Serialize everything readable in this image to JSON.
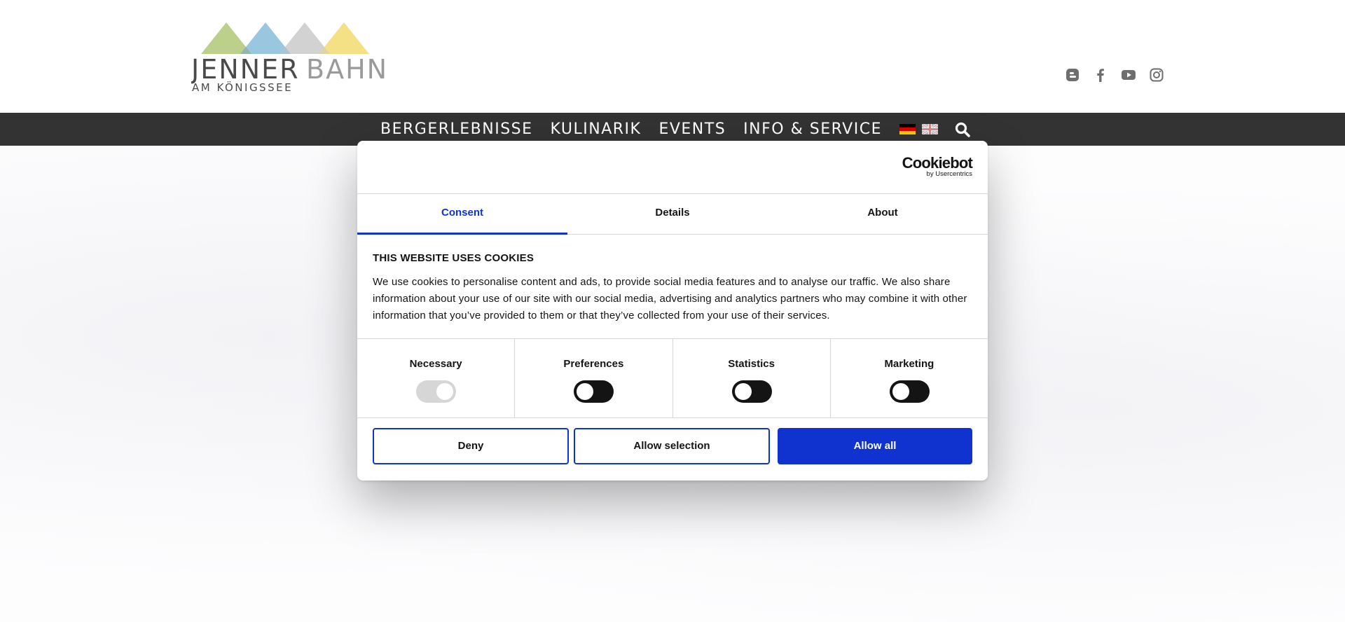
{
  "header": {
    "logo": {
      "brand_part1": "JENNER",
      "brand_part2": "BAHN",
      "tagline": "AM KÖNIGSSEE"
    },
    "social_icons": [
      "blogger-icon",
      "facebook-icon",
      "youtube-icon",
      "instagram-icon"
    ]
  },
  "nav": {
    "items": [
      {
        "label": "BERGERLEBNISSE"
      },
      {
        "label": "KULINARIK"
      },
      {
        "label": "EVENTS"
      },
      {
        "label": "INFO & SERVICE"
      }
    ],
    "flags": [
      "german-flag-icon",
      "uk-flag-icon"
    ],
    "search_icon": "search-icon"
  },
  "cookie_dialog": {
    "brand": "Cookiebot",
    "brand_sub": "by Usercentrics",
    "tabs": [
      {
        "label": "Consent",
        "active": true
      },
      {
        "label": "Details",
        "active": false
      },
      {
        "label": "About",
        "active": false
      }
    ],
    "title": "THIS WEBSITE USES COOKIES",
    "text": "We use cookies to personalise content and ads, to provide social media features and to analyse our traffic. We also share information about your use of our site with our social media, advertising and analytics partners who may combine it with other information that you’ve provided to them or that they’ve collected from your use of their services.",
    "categories": [
      {
        "label": "Necessary",
        "enabled": true,
        "locked": true
      },
      {
        "label": "Preferences",
        "enabled": false,
        "locked": false
      },
      {
        "label": "Statistics",
        "enabled": false,
        "locked": false
      },
      {
        "label": "Marketing",
        "enabled": false,
        "locked": false
      }
    ],
    "buttons": {
      "deny": "Deny",
      "allow_selection": "Allow selection",
      "allow_all": "Allow all"
    }
  },
  "colors": {
    "accent": "#1032cf",
    "nav_bg": "#333333",
    "text": "#141414"
  }
}
